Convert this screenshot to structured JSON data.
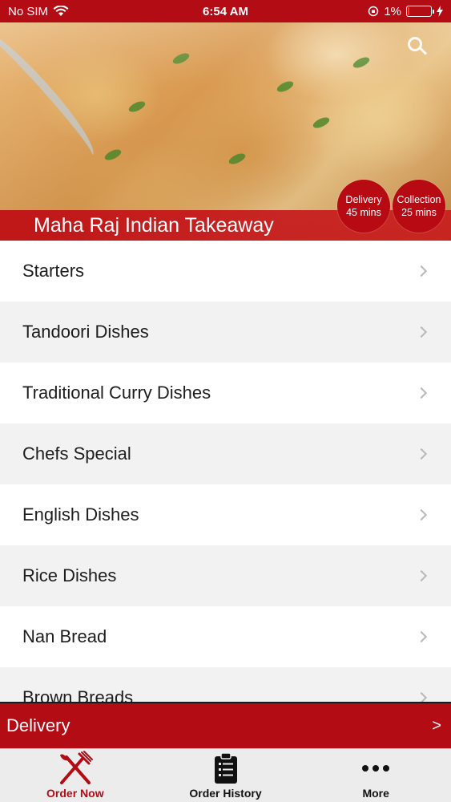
{
  "status_bar": {
    "carrier": "No SIM",
    "time": "6:54 AM",
    "battery_percent": "1%"
  },
  "header": {
    "restaurant_name": "Maha Raj Indian Takeaway",
    "delivery_badge": {
      "label": "Delivery",
      "time": "45 mins"
    },
    "collection_badge": {
      "label": "Collection",
      "time": "25 mins"
    }
  },
  "menu": {
    "items": [
      {
        "label": "Starters"
      },
      {
        "label": "Tandoori Dishes"
      },
      {
        "label": "Traditional Curry Dishes"
      },
      {
        "label": "Chefs Special"
      },
      {
        "label": "English Dishes"
      },
      {
        "label": "Rice Dishes"
      },
      {
        "label": "Nan Bread"
      },
      {
        "label": "Brown Breads"
      }
    ]
  },
  "order_bar": {
    "mode_label": "Delivery",
    "arrow": ">"
  },
  "tab_bar": {
    "tabs": [
      {
        "label": "Order Now",
        "icon": "fork-knife-icon",
        "active": true
      },
      {
        "label": "Order History",
        "icon": "clipboard-list-icon",
        "active": false
      },
      {
        "label": "More",
        "icon": "more-dots-icon",
        "active": false
      }
    ]
  },
  "colors": {
    "brand_red": "#b30c14",
    "tab_bar_bg": "#ececec",
    "row_alt_bg": "#f2f2f2"
  }
}
